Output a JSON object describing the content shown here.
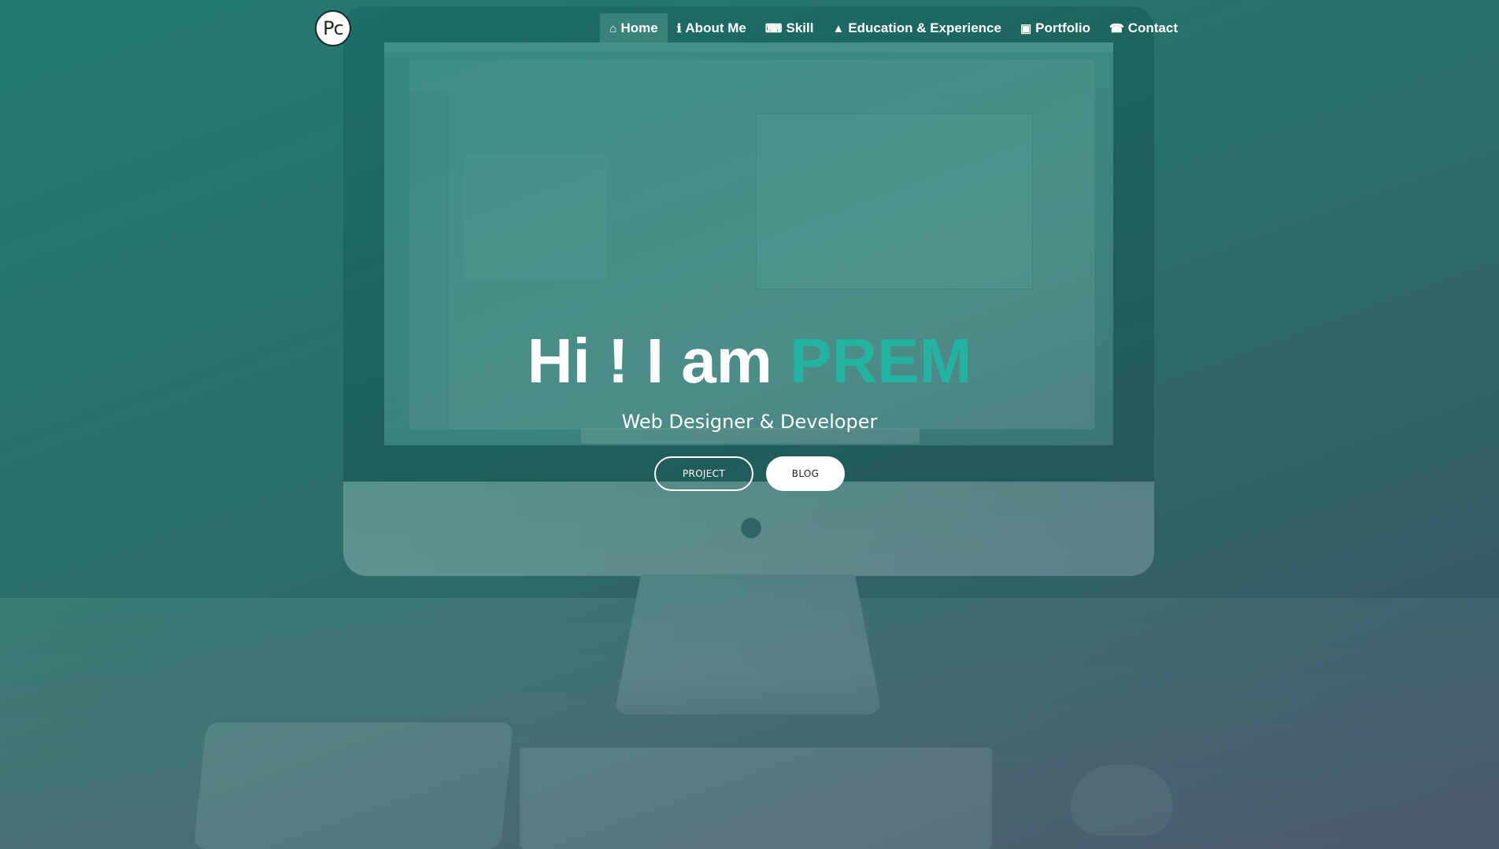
{
  "brand": {
    "logo_text": "Pc"
  },
  "nav": {
    "items": [
      {
        "label": "Home",
        "icon": "home-icon",
        "glyph": "⌂",
        "active": true
      },
      {
        "label": "About Me",
        "icon": "info-icon",
        "glyph": "ℹ",
        "active": false
      },
      {
        "label": "Skill",
        "icon": "keyboard-icon",
        "glyph": "⌨",
        "active": false
      },
      {
        "label": "Education & Experience",
        "icon": "graduation-cap-icon",
        "glyph": "🎓",
        "active": false
      },
      {
        "label": "Portfolio",
        "icon": "image-icon",
        "glyph": "▣",
        "active": false
      },
      {
        "label": "Contact",
        "icon": "phone-icon",
        "glyph": "☎",
        "active": false
      }
    ]
  },
  "hero": {
    "greeting": "Hi ! I am",
    "name": "PREM",
    "subtitle": "Web Designer & Developer",
    "buttons": {
      "project": "PROJECT",
      "blog": "BLOG"
    }
  },
  "colors": {
    "accent": "#24b3a2",
    "overlay_top": "#1a8076",
    "overlay_bottom": "#3a4862"
  }
}
